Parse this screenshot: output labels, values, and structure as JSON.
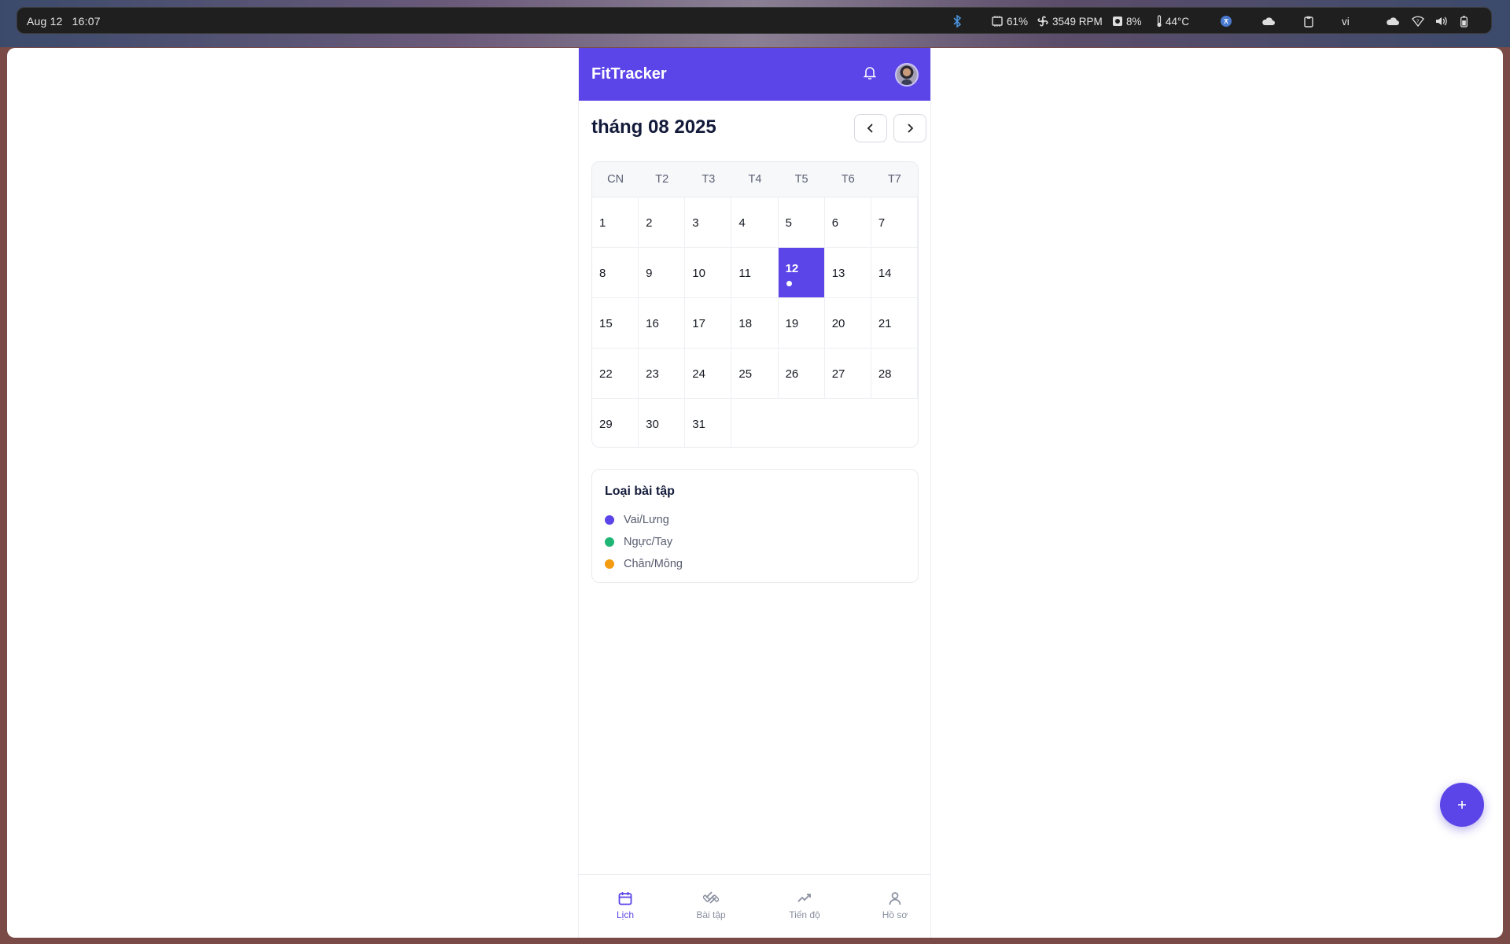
{
  "system_bar": {
    "date": "Aug 12",
    "time": "16:07",
    "cpu": "61%",
    "fan": "3549 RPM",
    "disk": "8%",
    "temp": "44°C",
    "lang": "vi"
  },
  "app": {
    "title": "FitTracker",
    "month_title": "tháng 08 2025",
    "weekdays": [
      "CN",
      "T2",
      "T3",
      "T4",
      "T5",
      "T6",
      "T7"
    ],
    "days": [
      "1",
      "2",
      "3",
      "4",
      "5",
      "6",
      "7",
      "8",
      "9",
      "10",
      "11",
      "12",
      "13",
      "14",
      "15",
      "16",
      "17",
      "18",
      "19",
      "20",
      "21",
      "22",
      "23",
      "24",
      "25",
      "26",
      "27",
      "28",
      "29",
      "30",
      "31"
    ],
    "today": "12"
  },
  "legend": {
    "title": "Loại bài tập",
    "items": [
      {
        "label": "Vai/Lưng",
        "color": "#5b45e8"
      },
      {
        "label": "Ngực/Tay",
        "color": "#1fb574"
      },
      {
        "label": "Chân/Mông",
        "color": "#f39c12"
      }
    ]
  },
  "nav": {
    "lich": "Lịch",
    "baitap": "Bài tập",
    "tiendo": "Tiến độ",
    "hoso": "Hồ sơ"
  },
  "fab": {
    "label": "+"
  }
}
